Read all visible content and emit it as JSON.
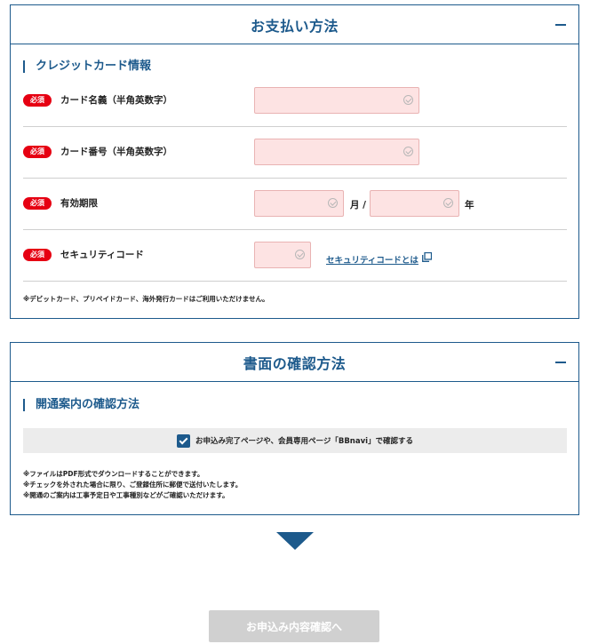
{
  "payment": {
    "title": "お支払い方法",
    "section_title": "クレジットカード情報",
    "required_badge": "必須",
    "fields": {
      "card_name": {
        "label": "カード名義（半角英数字）",
        "value": ""
      },
      "card_number": {
        "label": "カード番号（半角英数字）",
        "value": ""
      },
      "expiry": {
        "label": "有効期限",
        "month_unit": "月 /",
        "year_unit": "年",
        "month_value": "",
        "year_value": ""
      },
      "security": {
        "label": "セキュリティコード",
        "value": "",
        "help_link": "セキュリティコードとは"
      }
    },
    "note": "※デビットカード、プリペイドカード、海外発行カードはご利用いただけません。"
  },
  "document": {
    "title": "書面の確認方法",
    "section_title": "開通案内の確認方法",
    "checkbox_label": "お申込み完了ページや、会員専用ページ「BBnavi」で確認する",
    "checkbox_checked": true,
    "notes": [
      "※ファイルはPDF形式でダウンロードすることができます。",
      "※チェックを外された場合に限り、ご登録住所に郵便で送付いたします。",
      "※開通のご案内は工事予定日や工事種別などがご確認いただけます。"
    ]
  },
  "submit_label": "お申込み内容確認へ",
  "colors": {
    "primary": "#1d5a8c",
    "required": "#e60012",
    "input_bg": "#fde3e3",
    "submit_disabled": "#d0d0d0"
  }
}
